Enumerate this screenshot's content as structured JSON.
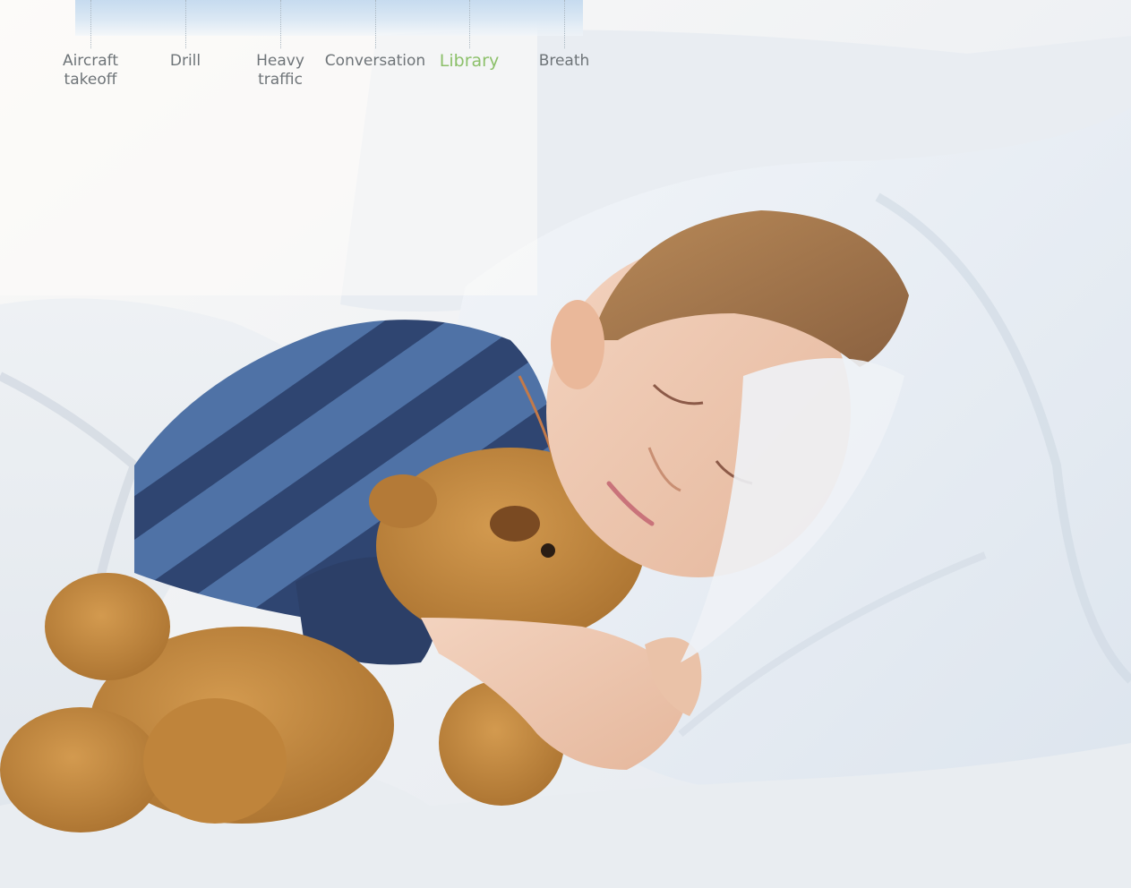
{
  "sound_scale": {
    "items": [
      {
        "label": "Aircraft\ntakeoff",
        "active": false
      },
      {
        "label": "Drill",
        "active": false
      },
      {
        "label": "Heavy\ntraffic",
        "active": false
      },
      {
        "label": "Conversation",
        "active": false
      },
      {
        "label": "Library",
        "active": true
      },
      {
        "label": "Breath",
        "active": false
      }
    ],
    "colors": {
      "band_top": "#c6dbef",
      "label": "#6e7478",
      "active_label": "#8cc06a"
    }
  }
}
